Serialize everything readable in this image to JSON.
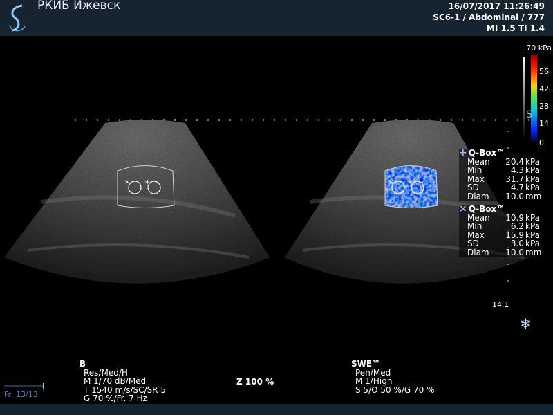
{
  "header": {
    "institution": "РКИБ Ижевск",
    "datetime": "16/07/2017 11:26:49",
    "probe_preset": "SC6-1 / Abdominal / 777",
    "indices": "MI 1.5  TI 1.4"
  },
  "colorbar": {
    "max_label": "+70 kPa",
    "ticks": [
      "56",
      "42",
      "28",
      "14",
      "0"
    ],
    "logo_glyph": "S"
  },
  "qboxes": [
    {
      "marker": "+",
      "title": "Q-Box™",
      "rows": [
        {
          "label": "Mean",
          "value": "20.4",
          "unit": "kPa"
        },
        {
          "label": "Min",
          "value": "4.3",
          "unit": "kPa"
        },
        {
          "label": "Max",
          "value": "31.7",
          "unit": "kPa"
        },
        {
          "label": "SD",
          "value": "4.7",
          "unit": "kPa"
        },
        {
          "label": "Diam",
          "value": "10.0",
          "unit": "mm"
        }
      ]
    },
    {
      "marker": "×",
      "title": "Q-Box™",
      "rows": [
        {
          "label": "Mean",
          "value": "10.9",
          "unit": "kPa"
        },
        {
          "label": "Min",
          "value": "6.2",
          "unit": "kPa"
        },
        {
          "label": "Max",
          "value": "15.9",
          "unit": "kPa"
        },
        {
          "label": "SD",
          "value": "3.0",
          "unit": "kPa"
        },
        {
          "label": "Diam",
          "value": "10.0",
          "unit": "mm"
        }
      ]
    }
  ],
  "depth": "14.1",
  "freeze_icon": "❄",
  "b_mode": {
    "title": "B",
    "lines": [
      "Res/Med/H",
      "M 1/70 dB/Med",
      "T 1540 m/s/SC/SR 5",
      "G 70 %/Fr. 7 Hz"
    ]
  },
  "swe_mode": {
    "title": "SWE™",
    "lines": [
      "Pen/Med",
      "M 1/High",
      "S 5/O 50 %/G 70 %"
    ]
  },
  "zoom": "Z  100  %",
  "frame": "Fr: 13/13",
  "colors": {
    "bar_bg": "#162331",
    "qbox_marker": "#8fb6ff",
    "frame_text": "#4c7fc0"
  }
}
